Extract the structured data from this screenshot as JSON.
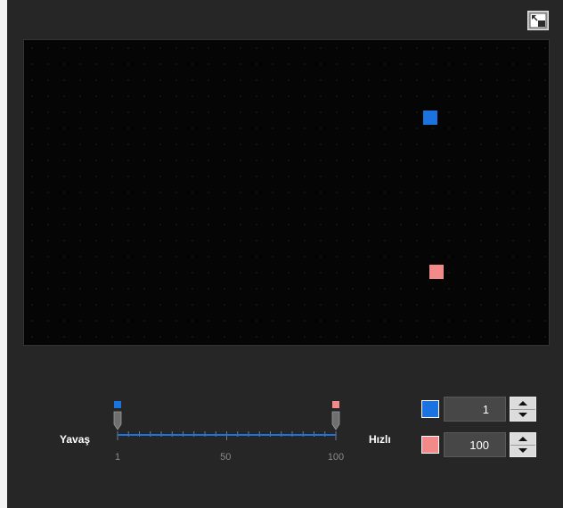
{
  "preview": {
    "markers": [
      {
        "id": "blue",
        "color": "#1a73e0"
      },
      {
        "id": "red",
        "color": "#f28a8a"
      }
    ],
    "expand_icon": "expand-icon"
  },
  "speed": {
    "slow_label": "Yavaş",
    "fast_label": "Hızlı",
    "scale_min": 1,
    "scale_max": 100,
    "tick_labels": [
      "1",
      "50",
      "100"
    ],
    "blue_value": 1,
    "red_value": 100
  },
  "inputs": {
    "blue": {
      "color": "#1a73e0",
      "value": "1"
    },
    "red": {
      "color": "#f28a8a",
      "value": "100"
    }
  },
  "colors": {
    "panel_bg": "#262626",
    "track": "#1a73e0"
  }
}
